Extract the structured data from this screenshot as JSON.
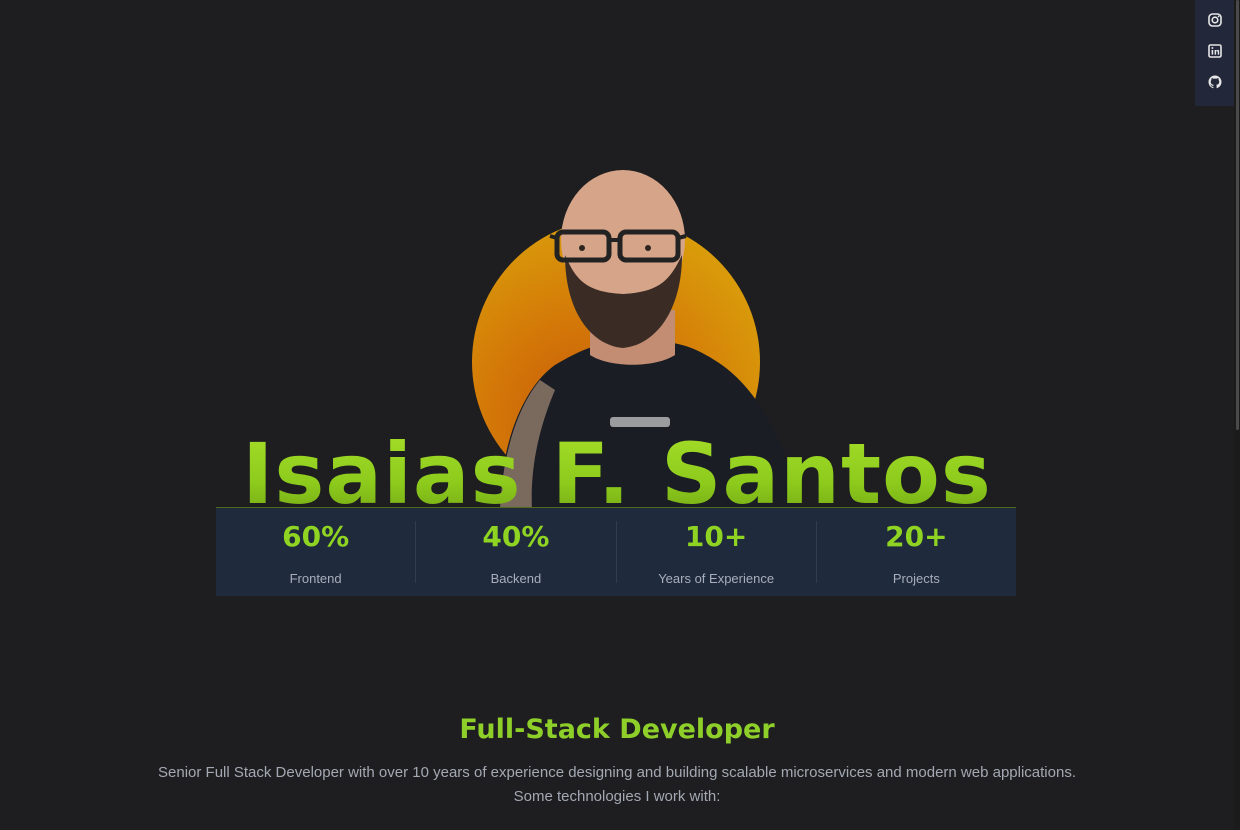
{
  "hero": {
    "name": "Isaias F. Santos"
  },
  "stats": [
    {
      "value": "60%",
      "label": "Frontend"
    },
    {
      "value": "40%",
      "label": "Backend"
    },
    {
      "value": "10+",
      "label": "Years of Experience"
    },
    {
      "value": "20+",
      "label": "Projects"
    }
  ],
  "about": {
    "title": "Full-Stack Developer",
    "line1": "Senior Full Stack Developer with over 10 years of experience designing and building scalable microservices and modern web applications.",
    "line2": "Some technologies I work with:"
  },
  "social": {
    "icons": [
      "instagram-icon",
      "linkedin-icon",
      "github-icon"
    ]
  },
  "colors": {
    "accent": "#8fd422",
    "background": "#1e1e20",
    "panel": "#1f2a3c",
    "sun": "#d98a0a"
  }
}
